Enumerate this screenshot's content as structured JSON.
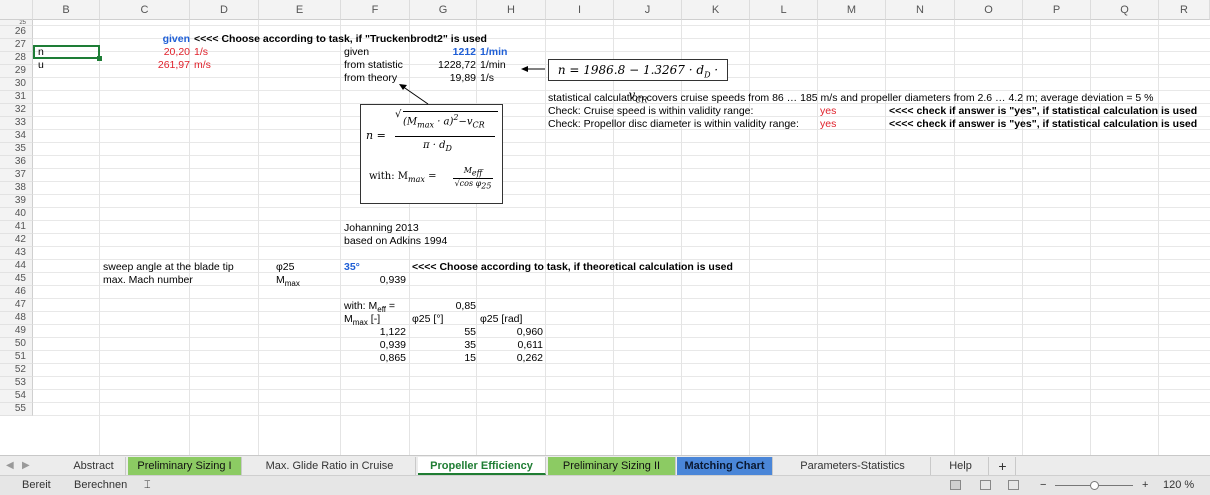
{
  "columns": [
    "B",
    "C",
    "D",
    "E",
    "F",
    "G",
    "H",
    "I",
    "J",
    "K",
    "L",
    "M",
    "N",
    "O",
    "P",
    "Q",
    "R"
  ],
  "rows": [
    "25",
    "26",
    "27",
    "28",
    "29",
    "30",
    "31",
    "32",
    "33",
    "34",
    "35",
    "36",
    "37",
    "38",
    "39",
    "40",
    "41",
    "42",
    "43",
    "44",
    "45",
    "46",
    "47",
    "48",
    "49",
    "50",
    "51",
    "52",
    "53",
    "54",
    "55"
  ],
  "cells": {
    "c26_given": "given",
    "c26_note": "<<<< Choose according to task, if \"Truckenbrodt2\" is used",
    "b27": "n",
    "c27": "20,20",
    "d27": "1/s",
    "f27": "given",
    "g27": "1212",
    "h27": "1/min",
    "b28": "u",
    "c28": "261,97",
    "d28": "m/s",
    "f28": "from statistic",
    "g28": "1228,72",
    "h28": "1/min",
    "f29": "from theory",
    "g29": "19,89",
    "h29": "1/s",
    "i30": "statistical calculation covers cruise speeds from 86 … 185 m/s and propeller diameters from 2.6 … 4.2 m; average deviation = 5 %",
    "i31": "Check: Cruise speed is within validity range:",
    "m31": "yes",
    "n31": "<<<< check if answer is \"yes\", if statistical calculation is used",
    "i32": "Check: Propellor disc diameter is within validity range:",
    "m32": "yes",
    "n32": "<<<< check if answer is \"yes\", if statistical calculation is used",
    "f39": "Johanning 2013",
    "f40": "based on Adkins 1994",
    "c42": "sweep angle at the blade tip",
    "e42": "φ25",
    "f42": "35°",
    "g42": "<<<< Choose according to task, if theoretical calculation is used",
    "c43": "max. Mach number",
    "e43_main": "M",
    "e43_sub": "max",
    "f43": "0,939",
    "f45_main": "with: M",
    "f45_sub": "eff",
    "f45_eq": " =",
    "g45": "0,85",
    "f46_main": "M",
    "f46_sub": "max",
    "f46_unit": " [-]",
    "g46": "φ25  [°]",
    "h46": "φ25 [rad]"
  },
  "table": [
    {
      "mmax": "1,122",
      "deg": "55",
      "rad": "0,960"
    },
    {
      "mmax": "0,939",
      "deg": "35",
      "rad": "0,611"
    },
    {
      "mmax": "0,865",
      "deg": "15",
      "rad": "0,262"
    }
  ],
  "formula_stat": "n = 1986.8 − 1.3267 · d",
  "formula_stat_sub1": "D",
  "formula_stat_mid": " · v",
  "formula_stat_sub2": "CR",
  "formula_theory": {
    "n_eq": "n =",
    "numer_a": "(M",
    "numer_a_sub": "max",
    "numer_b": " · a)",
    "numer_b_sup": "2",
    "numer_c": "−v",
    "numer_c_sub": "CR",
    "numer_c_sup": "2",
    "denom": "π · d",
    "denom_sub": "D",
    "with": "with: M",
    "with_sub": "max",
    "with_eq": " =",
    "frac2_num": "M",
    "frac2_num_sub": "eff",
    "frac2_den": "√cos φ",
    "frac2_den_sub": "25"
  },
  "tabs": [
    {
      "label": "Abstract",
      "style": "plain"
    },
    {
      "label": "Preliminary Sizing I",
      "style": "green"
    },
    {
      "label": "Max. Glide Ratio in Cruise",
      "style": "plain"
    },
    {
      "label": "Propeller Efficiency",
      "style": "active"
    },
    {
      "label": "Preliminary Sizing II",
      "style": "green"
    },
    {
      "label": "Matching Chart",
      "style": "blue"
    },
    {
      "label": "Parameters-Statistics",
      "style": "plain"
    },
    {
      "label": "Help",
      "style": "plain"
    }
  ],
  "add_sheet": "+",
  "status": {
    "ready": "Bereit",
    "calc": "Berechnen",
    "zoom": "120 %",
    "zoom_minus": "−",
    "zoom_plus": "+"
  },
  "colors": {
    "blue_input": "#1f5fd6",
    "red_value": "#e0212b",
    "tab_green": "#8ccb63",
    "tab_blue": "#4a86d8",
    "active_tab_text": "#1f7d33"
  }
}
